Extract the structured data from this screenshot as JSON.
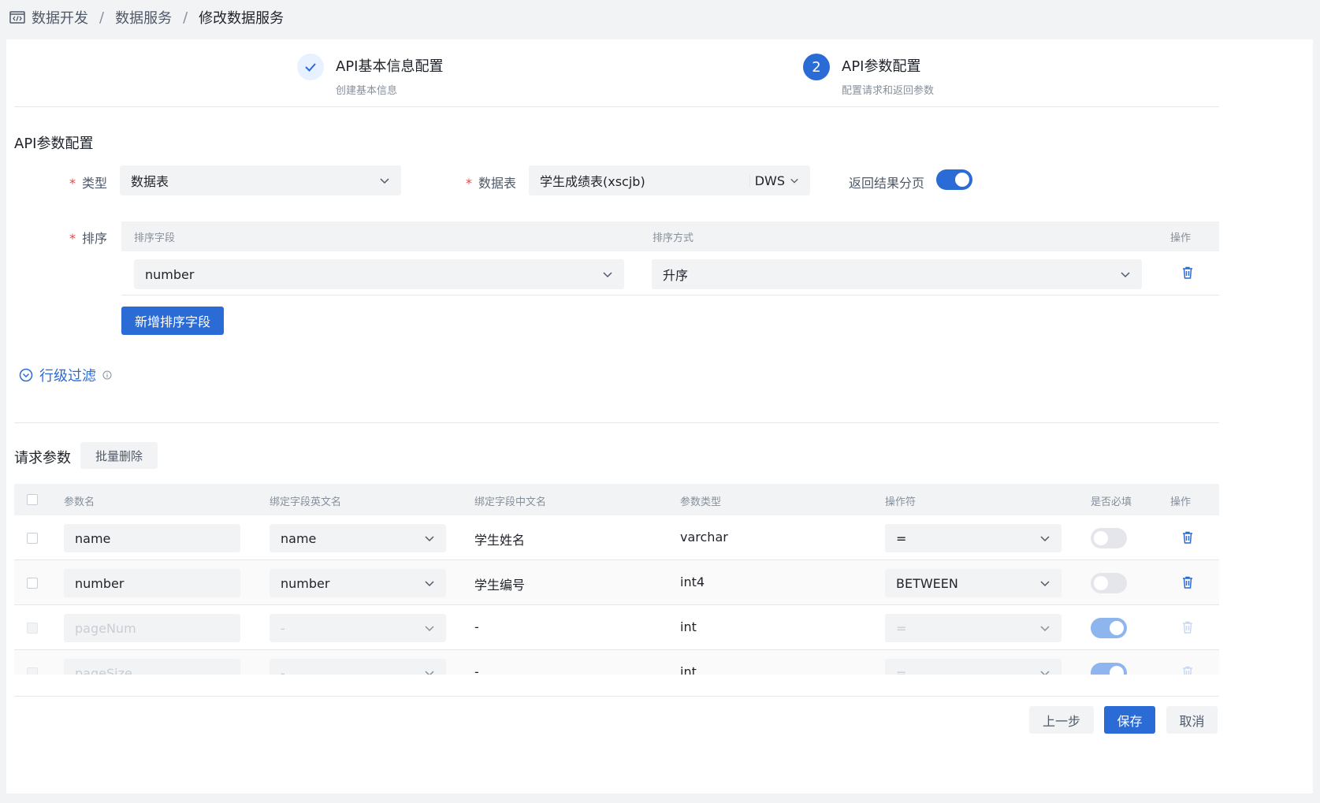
{
  "breadcrumb": {
    "icon": "code-window-icon",
    "items": [
      "数据开发",
      "数据服务",
      "修改数据服务"
    ],
    "separator": "/"
  },
  "steps": [
    {
      "title": "API基本信息配置",
      "desc": "创建基本信息",
      "status": "done",
      "number": "1"
    },
    {
      "title": "API参数配置",
      "desc": "配置请求和返回参数",
      "status": "active",
      "number": "2"
    }
  ],
  "section_title": "API参数配置",
  "form": {
    "type_label": "类型",
    "type_value": "数据表",
    "table_label": "数据表",
    "table_value": "学生成绩表(xscjb)",
    "table_source": "DWS",
    "paging_label": "返回结果分页",
    "paging_on": true,
    "sort_label": "排序",
    "required_mark": "*"
  },
  "sort_table": {
    "headers": [
      "排序字段",
      "排序方式",
      "操作"
    ],
    "rows": [
      {
        "field": "number",
        "order": "升序"
      }
    ],
    "add_button": "新增排序字段"
  },
  "row_filter": {
    "label": "行级过滤"
  },
  "request_params": {
    "title": "请求参数",
    "batch_delete": "批量删除",
    "headers": [
      "参数名",
      "绑定字段英文名",
      "绑定字段中文名",
      "参数类型",
      "操作符",
      "是否必填",
      "操作"
    ],
    "rows": [
      {
        "name": "name",
        "field_en": "name",
        "field_cn": "学生姓名",
        "type": "varchar",
        "operator": "=",
        "required": false,
        "disabled": false
      },
      {
        "name": "number",
        "field_en": "number",
        "field_cn": "学生编号",
        "type": "int4",
        "operator": "BETWEEN",
        "required": false,
        "disabled": false
      },
      {
        "name": "pageNum",
        "field_en": "-",
        "field_cn": "-",
        "type": "int",
        "operator": "=",
        "required": true,
        "disabled": true
      },
      {
        "name": "pageSize",
        "field_en": "-",
        "field_cn": "-",
        "type": "int",
        "operator": "=",
        "required": true,
        "disabled": true
      }
    ]
  },
  "footer": {
    "prev": "上一步",
    "save": "保存",
    "cancel": "取消"
  },
  "colors": {
    "primary": "#2b6bd6",
    "danger": "#f53f3f",
    "background": "#f2f3f5"
  }
}
